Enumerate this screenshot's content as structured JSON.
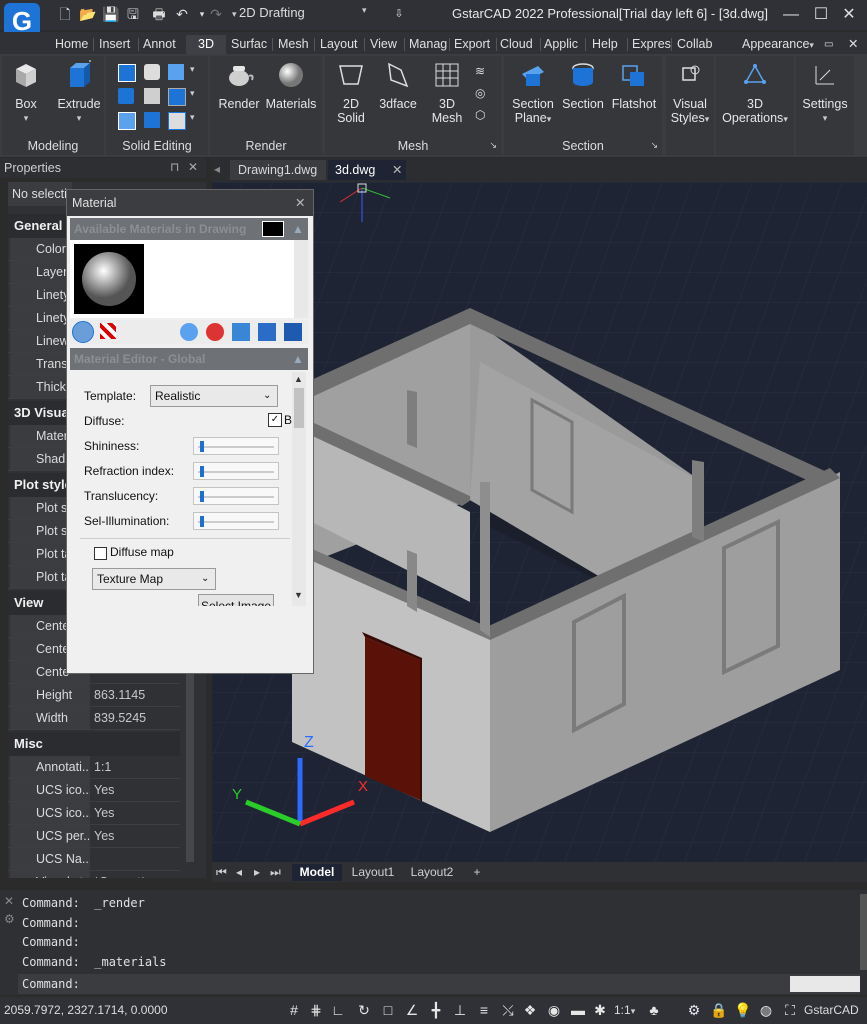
{
  "app": {
    "title": "GstarCAD 2022 Professional[Trial day left 6] - [3d.dwg]",
    "logo_letter": "G",
    "workspace": "2D Drafting"
  },
  "ribbon_tabs": [
    "Home",
    "Insert",
    "Annot",
    "3D",
    "Surfac",
    "Mesh",
    "Layout",
    "View",
    "Manag",
    "Export",
    "Cloud",
    "Applic",
    "Help",
    "Expres",
    "Collab"
  ],
  "ribbon_active_tab": "3D",
  "appearance_label": "Appearance",
  "panels": {
    "modeling": {
      "title": "Modeling",
      "box": "Box",
      "extrude": "Extrude"
    },
    "solid_editing": {
      "title": "Solid Editing"
    },
    "render": {
      "title": "Render",
      "render": "Render",
      "materials": "Materials"
    },
    "mesh": {
      "title": "Mesh",
      "solid2d_line1": "2D",
      "solid2d_line2": "Solid",
      "face3d": "3dface",
      "mesh3d_line1": "3D",
      "mesh3d_line2": "Mesh"
    },
    "section": {
      "title": "Section",
      "section_plane_line1": "Section",
      "section_plane_line2": "Plane",
      "section": "Section",
      "flatshot": "Flatshot"
    },
    "visual_styles": {
      "line1": "Visual",
      "line2": "Styles"
    },
    "operations": {
      "line1": "3D",
      "line2": "Operations"
    },
    "settings": {
      "label": "Settings"
    }
  },
  "properties": {
    "title": "Properties",
    "selection": "No selecti",
    "sections": [
      {
        "name": "General",
        "rows": [
          [
            "Color",
            ""
          ],
          [
            "Layer",
            ""
          ],
          [
            "Linety",
            ""
          ],
          [
            "Linety",
            ""
          ],
          [
            "Linew",
            ""
          ],
          [
            "Trans",
            ""
          ],
          [
            "Thick",
            ""
          ]
        ]
      },
      {
        "name": "3D Visua",
        "rows": [
          [
            "Mater",
            ""
          ],
          [
            "Shad",
            ""
          ]
        ]
      },
      {
        "name": "Plot style",
        "rows": [
          [
            "Plot s",
            ""
          ],
          [
            "Plot s",
            ""
          ],
          [
            "Plot ta",
            ""
          ],
          [
            "Plot ta",
            ""
          ]
        ]
      },
      {
        "name": "View",
        "rows": [
          [
            "Cente",
            ""
          ],
          [
            "Cente",
            ""
          ],
          [
            "Cente",
            ""
          ],
          [
            "Height",
            "863.1145"
          ],
          [
            "Width",
            "839.5245"
          ]
        ]
      },
      {
        "name": "Misc",
        "rows": [
          [
            "Annotati...",
            "1:1"
          ],
          [
            "UCS ico...",
            "Yes"
          ],
          [
            "UCS ico...",
            "Yes"
          ],
          [
            "UCS per...",
            "Yes"
          ],
          [
            "UCS Na...",
            ""
          ],
          [
            "Visual st...",
            "*Current*"
          ]
        ]
      }
    ]
  },
  "material": {
    "title": "Material",
    "available_header": "Available Materials in Drawing",
    "editor_header": "Material Editor - Global",
    "template_label": "Template:",
    "template_value": "Realistic",
    "diffuse_label": "Diffuse:",
    "diffuse_check_label": "B",
    "shininess_label": "Shininess:",
    "refraction_label": "Refraction index:",
    "translucency_label": "Translucency:",
    "selfillum_label": "Sel-Illumination:",
    "diffuse_map_label": "Diffuse map",
    "texture_map_value": "Texture Map",
    "select_image_label": "Select Image"
  },
  "doc_tabs": [
    "Drawing1.dwg",
    "3d.dwg"
  ],
  "active_doc_tab": "3d.dwg",
  "layout_tabs": [
    "Model",
    "Layout1",
    "Layout2",
    "+"
  ],
  "active_layout": "Model",
  "ucs_labels": {
    "x": "X",
    "y": "Y",
    "z": "Z"
  },
  "command_history": [
    "Command:  _render",
    "Command:",
    "Command:",
    "Command:  _materials"
  ],
  "command_prompt": "Command:",
  "status": {
    "coordinates": "2059.7972, 2327.1714, 0.0000",
    "scale": "1:1",
    "app_name": "GstarCAD"
  },
  "colors": {
    "accent": "#1e73d6",
    "door": "#5a1208",
    "viewport_bg": "#1e2433"
  }
}
